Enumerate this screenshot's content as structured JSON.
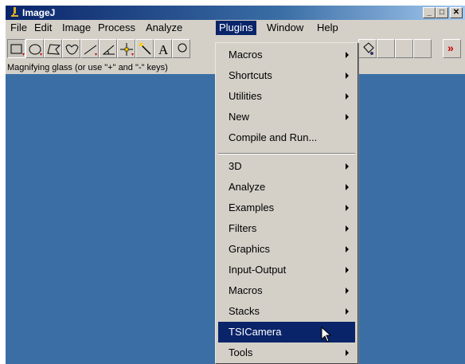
{
  "window": {
    "title": "ImageJ",
    "controls": {
      "minimize": "_",
      "maximize": "□",
      "close": "✕"
    }
  },
  "menubar": {
    "items": [
      "File",
      "Edit",
      "Image",
      "Process",
      "Analyze",
      "Plugins",
      "Window",
      "Help"
    ],
    "active": "Plugins"
  },
  "toolbar": {
    "tools": [
      "rectangle-tool",
      "oval-tool",
      "polygon-tool",
      "freehand-tool",
      "line-tool",
      "angle-tool",
      "point-tool",
      "wand-tool",
      "text-tool"
    ],
    "more_label": "»",
    "status": "Magnifying glass (or use \"+\" and \"-\" keys)"
  },
  "plugins_menu": {
    "group1": [
      {
        "label": "Macros",
        "submenu": true
      },
      {
        "label": "Shortcuts",
        "submenu": true
      },
      {
        "label": "Utilities",
        "submenu": true
      },
      {
        "label": "New",
        "submenu": true
      },
      {
        "label": "Compile and Run...",
        "submenu": false
      }
    ],
    "group2": [
      {
        "label": "3D",
        "submenu": true
      },
      {
        "label": "Analyze",
        "submenu": true
      },
      {
        "label": "Examples",
        "submenu": true
      },
      {
        "label": "Filters",
        "submenu": true
      },
      {
        "label": "Graphics",
        "submenu": true
      },
      {
        "label": "Input-Output",
        "submenu": true
      },
      {
        "label": "Macros",
        "submenu": true
      },
      {
        "label": "Stacks",
        "submenu": true
      },
      {
        "label": "TSICamera",
        "submenu": false,
        "highlighted": true
      },
      {
        "label": "Tools",
        "submenu": true
      }
    ]
  },
  "colors": {
    "desktop": "#3a6ea5",
    "highlight": "#0a246a",
    "chrome": "#d4d0c8",
    "more_arrows": "#cc0000"
  }
}
